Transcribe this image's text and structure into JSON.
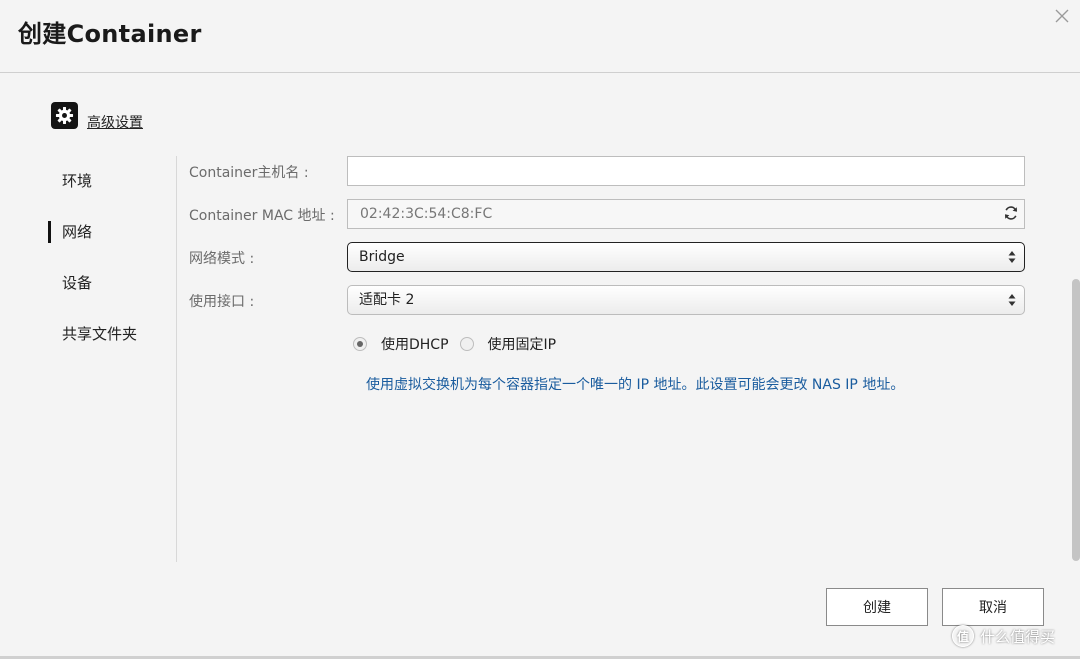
{
  "dialog": {
    "title": "创建Container"
  },
  "section": {
    "title": "高级设置",
    "icon": "gear-icon"
  },
  "sidebar": {
    "items": [
      {
        "label": "环境",
        "active": false
      },
      {
        "label": "网络",
        "active": true
      },
      {
        "label": "设备",
        "active": false
      },
      {
        "label": "共享文件夹",
        "active": false
      }
    ]
  },
  "form": {
    "hostname": {
      "label": "Container主机名 :",
      "value": ""
    },
    "mac": {
      "label": "Container MAC 地址 :",
      "value": "02:42:3C:54:C8:FC"
    },
    "network_mode": {
      "label": "网络模式 :",
      "value": "Bridge"
    },
    "interface": {
      "label": "使用接口 :",
      "value": "适配卡 2"
    },
    "ip_mode": {
      "options": [
        {
          "label": "使用DHCP",
          "checked": true
        },
        {
          "label": "使用固定IP",
          "checked": false
        }
      ]
    },
    "info": "使用虚拟交换机为每个容器指定一个唯一的 IP 地址。此设置可能会更改 NAS IP 地址。"
  },
  "buttons": {
    "create": "创建",
    "cancel": "取消"
  },
  "watermark": {
    "text": "什么值得买",
    "icon_glyph": "值"
  },
  "colors": {
    "info_text": "#1a5c9e",
    "background": "#f4f4f4"
  }
}
